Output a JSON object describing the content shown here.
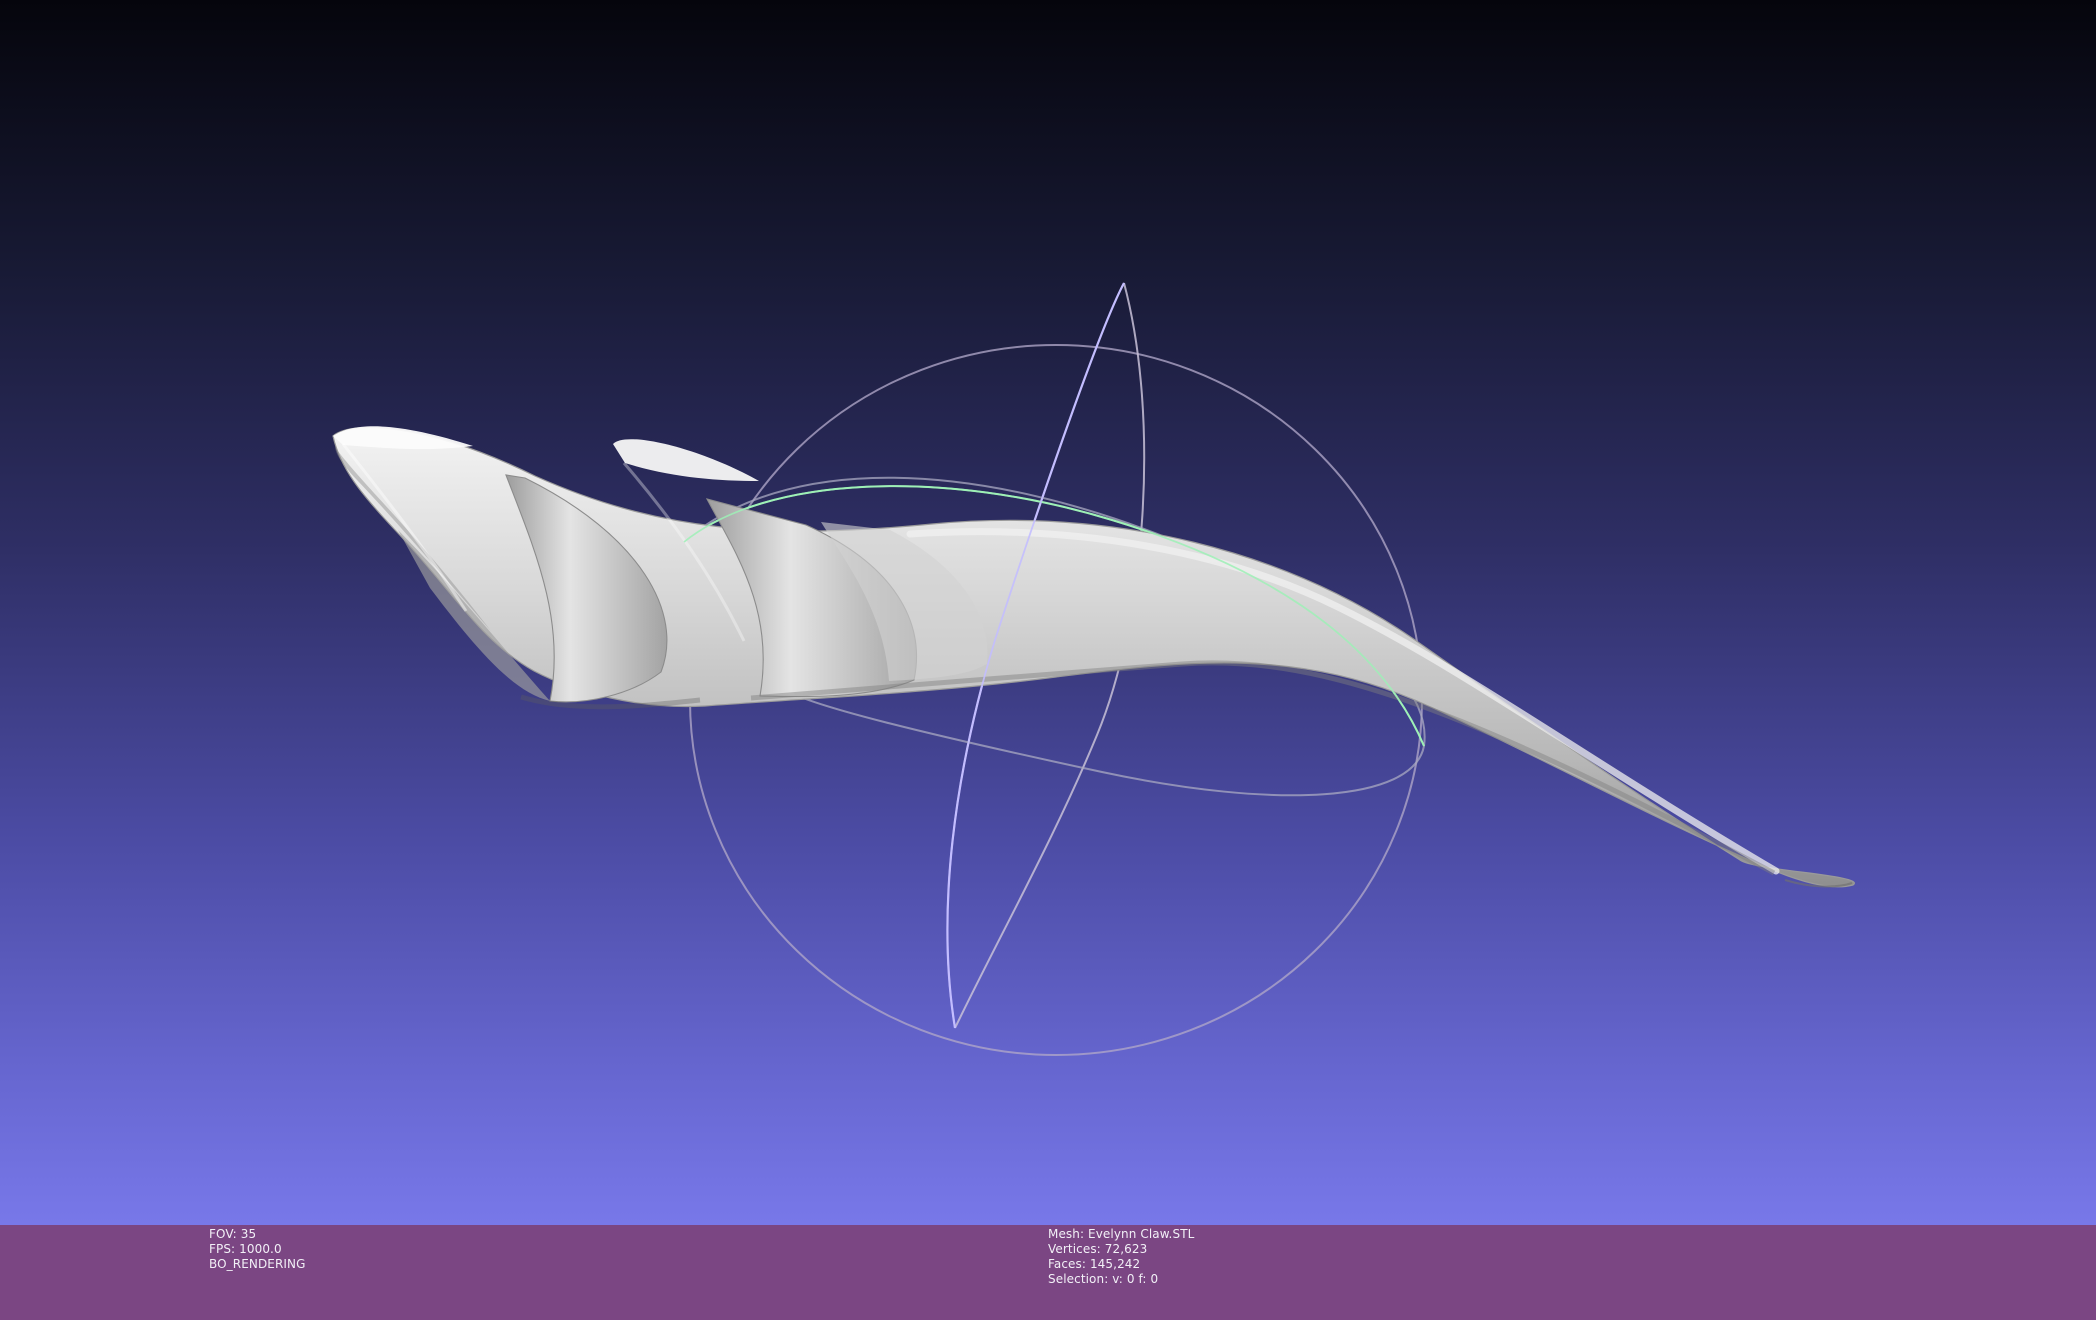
{
  "viewport": {
    "background_top": "#05050c",
    "background_bottom": "#7878e9",
    "trackball_colors": {
      "x_axis": "#b8b0ff",
      "y_axis": "#99e6b3",
      "z_axis": "#b0a6c8"
    }
  },
  "status_bar": {
    "background": "#7b4683",
    "left_lines": [
      "FOV: 35",
      "FPS:  1000.0",
      "BO_RENDERING"
    ],
    "right_lines": [
      "Mesh: Evelynn Claw.STL",
      "Vertices: 72,623",
      "Faces: 145,242",
      "Selection: v: 0 f: 0"
    ]
  }
}
